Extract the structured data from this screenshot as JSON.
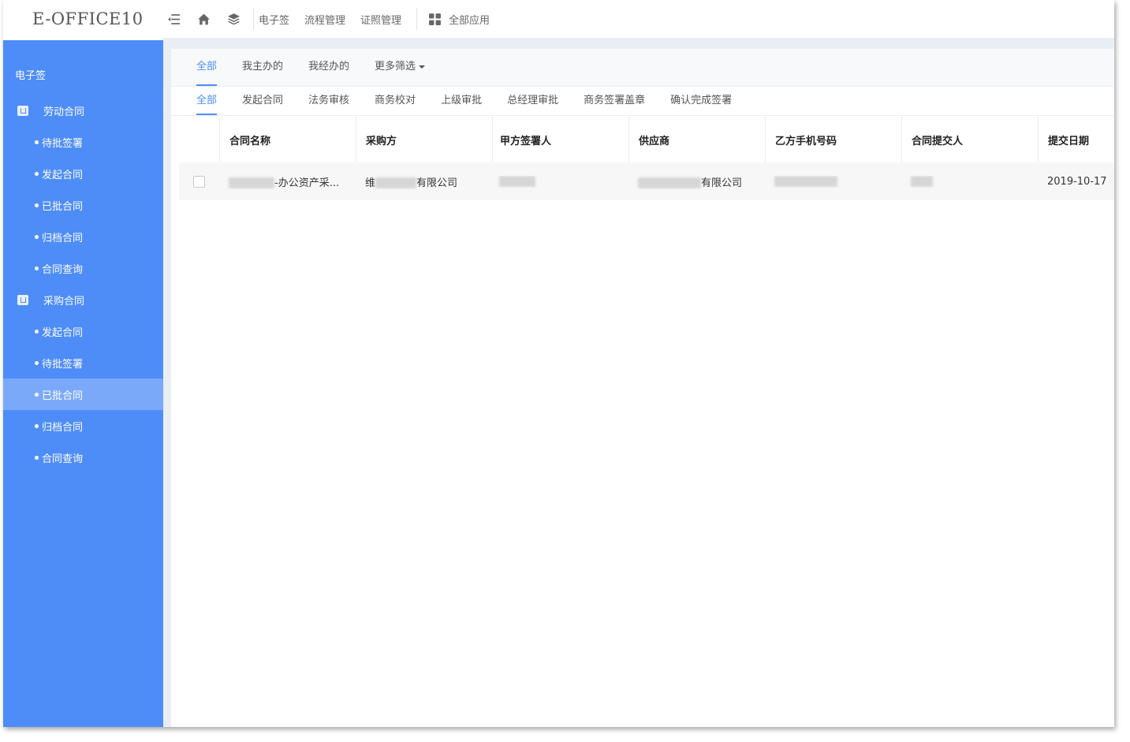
{
  "app": {
    "brand": "E-OFFICE10"
  },
  "topnav": {
    "links": [
      "电子签",
      "流程管理",
      "证照管理"
    ],
    "apps_label": "全部应用"
  },
  "sidebar": {
    "title": "电子签",
    "groups": [
      {
        "label": "劳动合同",
        "items": [
          "待批签署",
          "发起合同",
          "已批合同",
          "归档合同",
          "合同查询"
        ]
      },
      {
        "label": "采购合同",
        "items": [
          "发起合同",
          "待批签署",
          "已批合同",
          "归档合同",
          "合同查询"
        ]
      }
    ],
    "active": "采购合同/已批合同"
  },
  "filters": {
    "tabs": [
      "全部",
      "我主办的",
      "我经办的",
      "更多筛选"
    ],
    "active": "全部"
  },
  "steps": {
    "tabs": [
      "全部",
      "发起合同",
      "法务审核",
      "商务校对",
      "上级审批",
      "总经理审批",
      "商务签署盖章",
      "确认完成签署"
    ],
    "active": "全部"
  },
  "table": {
    "columns": [
      "合同名称",
      "采购方",
      "甲方签署人",
      "供应商",
      "乙方手机号码",
      "合同提交人",
      "提交日期"
    ],
    "rows": [
      {
        "name_suffix": "-办公资产采...",
        "buyer_prefix": "维",
        "buyer_suffix": "有限公司",
        "supplier_suffix": "有限公司",
        "date": "2019-10-17"
      }
    ]
  },
  "colors": {
    "accent": "#4e8df8",
    "sidebar": "#4e8df8",
    "sidebar_active": "#7aa9fa"
  }
}
